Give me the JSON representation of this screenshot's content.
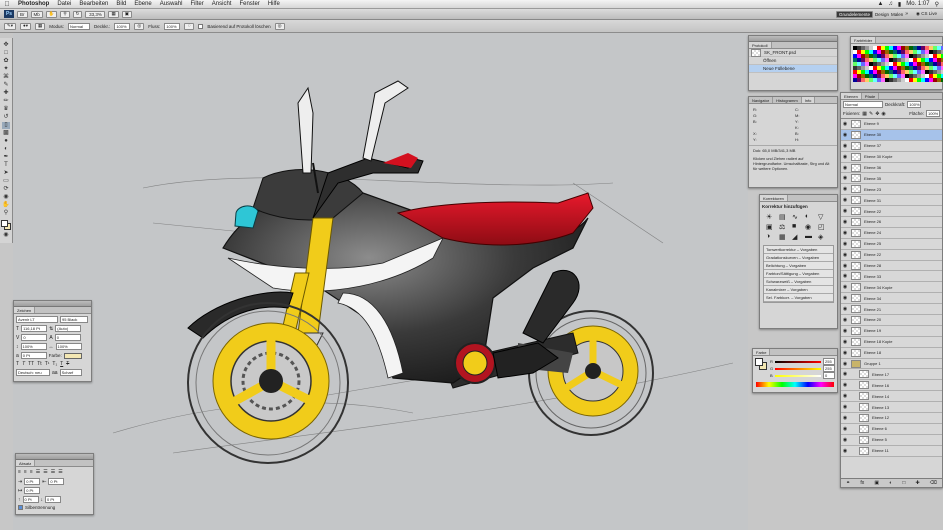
{
  "menubar": {
    "apple": "",
    "app_name": "Photoshop",
    "items": [
      "Datei",
      "Bearbeiten",
      "Bild",
      "Ebene",
      "Auswahl",
      "Filter",
      "Ansicht",
      "Fenster",
      "Hilfe"
    ],
    "clock": "Mo. 1:07"
  },
  "appbar": {
    "logo": "Ps",
    "zoom": "33,3%",
    "workspaces": [
      "Grundelemente",
      "Design",
      "Malen"
    ],
    "cs_live": "CS Live"
  },
  "options": {
    "mode_label": "Modus:",
    "mode_value": "Normal",
    "opacity_label": "Deckkr.:",
    "opacity_value": "100%",
    "flow_label": "Fluss:",
    "flow_value": "100%",
    "protocol_label": "Basierend auf Protokoll löschen"
  },
  "history": {
    "tabs": [
      "Protokoll"
    ],
    "doc": "SK_FRONT.psd",
    "items": [
      "Öffnen",
      "Neue Füllebene"
    ]
  },
  "info": {
    "tabs": [
      "Navigator",
      "Histogramm",
      "Info"
    ],
    "labels": [
      "R:",
      "G:",
      "B:",
      "C:",
      "M:",
      "Y:",
      "K:",
      "X:",
      "Y:",
      "B:",
      "H:"
    ],
    "doc_size": "Dok: 65,0 MB/341,3 MB",
    "help": "Klicken und Ziehen radiert auf Hintergrundfarbe. Umschalttaste, Strg und Alt für weitere Optionen."
  },
  "corrections": {
    "tabs": [
      "Korrekturen"
    ],
    "title": "Korrektur hinzufügen",
    "presets": [
      "Tonwertkorrektur – Vorgaben",
      "Gradationskurven – Vorgaben",
      "Belichtung – Vorgaben",
      "Farbton/Sättigung – Vorgaben",
      "Schwarzweiß – Vorgaben",
      "Kanalmixer – Vorgaben",
      "Sel. Farbkorr. – Vorgaben"
    ]
  },
  "color": {
    "tabs": [
      "Farbe"
    ],
    "channels": [
      {
        "name": "R",
        "value": "255"
      },
      {
        "name": "G",
        "value": "255"
      },
      {
        "name": "B",
        "value": "0"
      }
    ]
  },
  "swatches": {
    "tabs": [
      "Farbfelder"
    ],
    "colors": [
      "#000000",
      "#333333",
      "#666666",
      "#999999",
      "#cccccc",
      "#ffffff",
      "#ff0000",
      "#ffff00",
      "#00ff00",
      "#00ffff",
      "#0000ff",
      "#ff00ff",
      "#990000",
      "#996600",
      "#006600",
      "#006666",
      "#000099",
      "#660066",
      "#ff6666",
      "#ffcc66",
      "#66ff66",
      "#66ffff",
      "#6666ff",
      "#ff66ff"
    ]
  },
  "layers": {
    "tabs": [
      "Ebenen",
      "Pfade"
    ],
    "blend": "Normal",
    "opacity_label": "Deckkraft:",
    "opacity_value": "100%",
    "lock_label": "Fixieren:",
    "fill_label": "Fläche:",
    "fill_value": "100%",
    "items": [
      {
        "name": "Ebene 9",
        "sel": false
      },
      {
        "name": "Ebene 30",
        "sel": true
      },
      {
        "name": "Ebene 37",
        "sel": false
      },
      {
        "name": "Ebene 30 Kopie",
        "sel": false
      },
      {
        "name": "Ebene 36",
        "sel": false
      },
      {
        "name": "Ebene 35",
        "sel": false
      },
      {
        "name": "Ebene 23",
        "sel": false
      },
      {
        "name": "Ebene 31",
        "sel": false
      },
      {
        "name": "Ebene 22",
        "sel": false
      },
      {
        "name": "Ebene 26",
        "sel": false
      },
      {
        "name": "Ebene 24",
        "sel": false
      },
      {
        "name": "Ebene 25",
        "sel": false
      },
      {
        "name": "Ebene 22",
        "sel": false
      },
      {
        "name": "Ebene 28",
        "sel": false
      },
      {
        "name": "Ebene 33",
        "sel": false
      },
      {
        "name": "Ebene 34 Kopie",
        "sel": false
      },
      {
        "name": "Ebene 34",
        "sel": false
      },
      {
        "name": "Ebene 21",
        "sel": false
      },
      {
        "name": "Ebene 20",
        "sel": false
      },
      {
        "name": "Ebene 19",
        "sel": false
      },
      {
        "name": "Ebene 18 Kopie",
        "sel": false
      },
      {
        "name": "Ebene 18",
        "sel": false
      },
      {
        "name": "Gruppe 1",
        "sel": false
      },
      {
        "name": "Ebene 17",
        "sel": false
      },
      {
        "name": "Ebene 16",
        "sel": false
      },
      {
        "name": "Ebene 14",
        "sel": false
      },
      {
        "name": "Ebene 13",
        "sel": false
      },
      {
        "name": "Ebene 12",
        "sel": false
      },
      {
        "name": "Ebene 6",
        "sel": false
      },
      {
        "name": "Ebene 5",
        "sel": false
      },
      {
        "name": "Ebene 11",
        "sel": false
      }
    ]
  },
  "character": {
    "tabs": [
      "Zeichen"
    ],
    "font": "Avenir LT",
    "style": "95 Black",
    "size": "116,18 Pt",
    "leading": "(Auto)",
    "kerning": "0",
    "tracking": "0",
    "vscale": "100%",
    "hscale": "100%",
    "baseline": "0 Pt",
    "color_label": "Farbe:",
    "language": "Deutsch: neu",
    "aa": "Scharf"
  },
  "paragraph": {
    "tabs": [
      "Absatz"
    ],
    "fields": [
      "0 Pt",
      "0 Pt",
      "0 Pt",
      "0 Pt",
      "0 Pt"
    ],
    "hyphenate": "Silbentrennung"
  }
}
